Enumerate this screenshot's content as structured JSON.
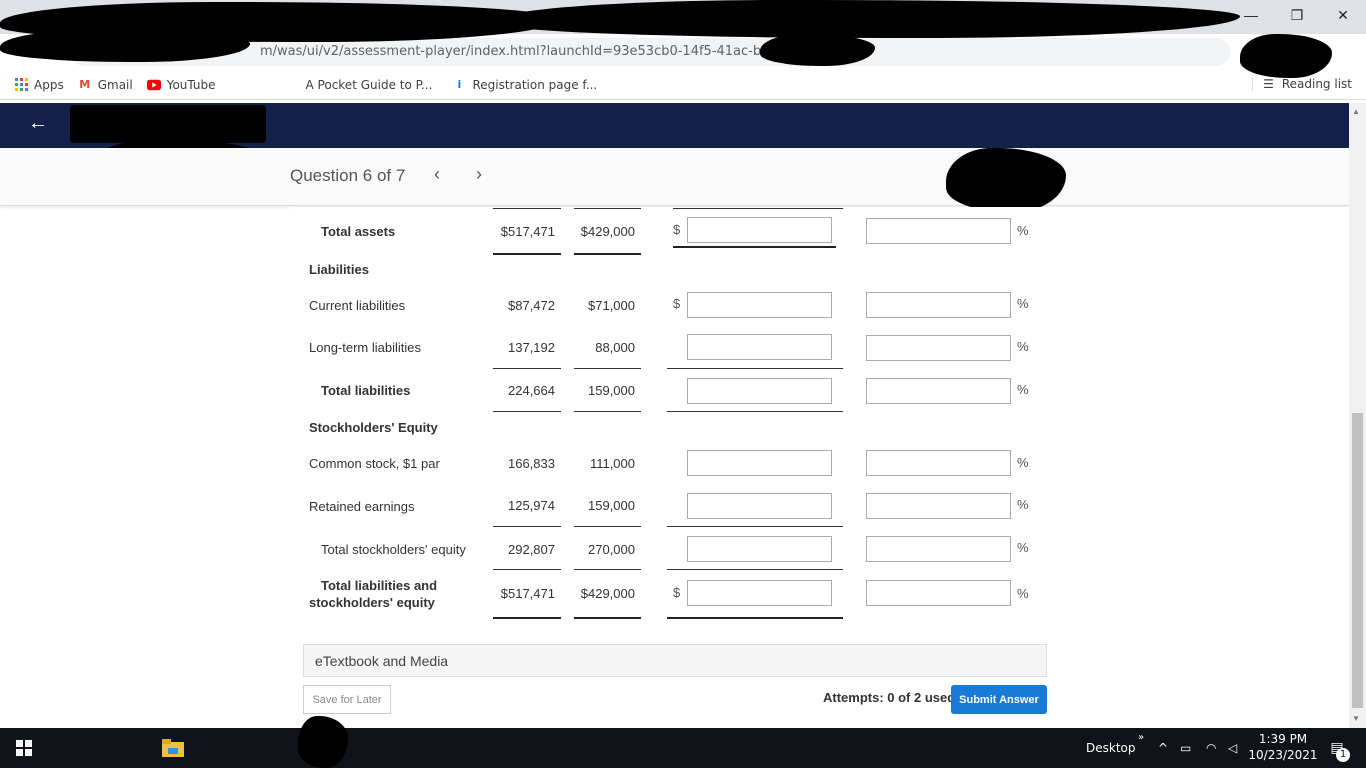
{
  "browser": {
    "url_visible": "m/was/ui/v2/assessment-player/index.html?launchId=93e53cb0-14f5-41ac-b2...   estion/5",
    "bookmarks": [
      {
        "label": "Apps",
        "icon": "apps-grid-icon"
      },
      {
        "label": "Gmail",
        "icon": "gmail-icon"
      },
      {
        "label": "YouTube",
        "icon": "youtube-icon"
      },
      {
        "label": "A Pocket Guide to P...",
        "icon": "bookmark-icon"
      },
      {
        "label": "Registration page f...",
        "icon": "info-icon"
      }
    ],
    "reading_list": "Reading list"
  },
  "question": {
    "title": "Question 6 of 7",
    "prev": "‹",
    "next": "›"
  },
  "table": {
    "total_assets": {
      "label": "Total assets",
      "y1": "$517,471",
      "y2": "$429,000",
      "dollar": "$",
      "pct": "%"
    },
    "liabilities_heading": "Liabilities",
    "current_liabilities": {
      "label": "Current liabilities",
      "y1": "$87,472",
      "y2": "$71,000",
      "dollar": "$",
      "pct": "%"
    },
    "long_term_liabilities": {
      "label": "Long-term liabilities",
      "y1": "137,192",
      "y2": "88,000",
      "pct": "%"
    },
    "total_liabilities": {
      "label": "Total liabilities",
      "y1": "224,664",
      "y2": "159,000",
      "pct": "%"
    },
    "equity_heading": "Stockholders' Equity",
    "common_stock": {
      "label": "Common stock, $1 par",
      "y1": "166,833",
      "y2": "111,000",
      "pct": "%"
    },
    "retained_earnings": {
      "label": "Retained earnings",
      "y1": "125,974",
      "y2": "159,000",
      "pct": "%"
    },
    "total_equity": {
      "label": "Total stockholders' equity",
      "y1": "292,807",
      "y2": "270,000",
      "pct": "%"
    },
    "total_liab_equity": {
      "label_line1": "Total liabilities and",
      "label_line2": "stockholders' equity",
      "y1": "$517,471",
      "y2": "$429,000",
      "dollar": "$",
      "pct": "%"
    }
  },
  "footer": {
    "etextbook": "eTextbook and Media",
    "save": "Save for Later",
    "attempts": "Attempts: 0 of 2 used",
    "submit": "Submit Answer"
  },
  "taskbar": {
    "desktop": "Desktop",
    "time": "1:39 PM",
    "date": "10/23/2021",
    "notifications": "1"
  }
}
